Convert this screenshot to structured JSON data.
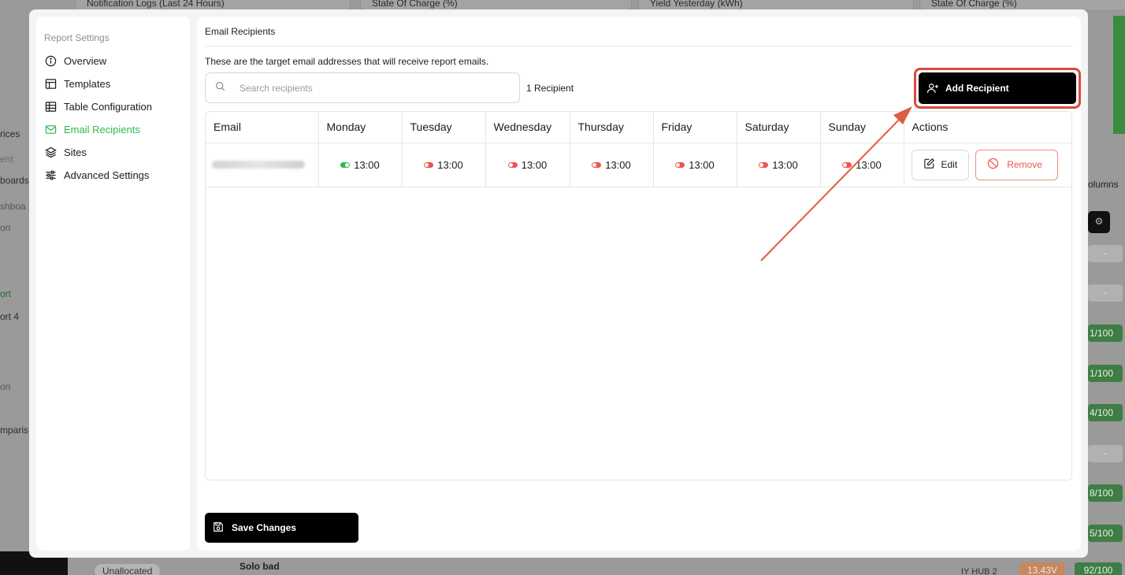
{
  "background": {
    "top_cards": [
      "Notification Logs (Last 24 Hours)",
      "State Of Charge (%)",
      "Yield Yesterday (kWh)",
      "State Of Charge (%)"
    ],
    "left_nav": [
      "rices",
      "ent",
      "boards",
      "shboa",
      "on",
      "ort",
      "ort 4",
      "on",
      "mparis"
    ],
    "right_columns_label": "olumns",
    "right_scores": [
      "1/100",
      "1/100",
      "4/100",
      "8/100",
      "5/100"
    ],
    "bottom_row": {
      "status": "Unallocated",
      "name": "Solo bad",
      "hub": "IY HUB 2",
      "voltage": "13.43V",
      "score": "92/100"
    }
  },
  "sidebar": {
    "title": "Report Settings",
    "items": [
      {
        "label": "Overview",
        "icon": "info-icon",
        "active": false
      },
      {
        "label": "Templates",
        "icon": "layout-icon",
        "active": false
      },
      {
        "label": "Table Configuration",
        "icon": "table-icon",
        "active": false
      },
      {
        "label": "Email Recipients",
        "icon": "mail-icon",
        "active": true
      },
      {
        "label": "Sites",
        "icon": "layers-icon",
        "active": false
      },
      {
        "label": "Advanced Settings",
        "icon": "sliders-icon",
        "active": false
      }
    ]
  },
  "main": {
    "title": "Email Recipients",
    "description": "These are the target email addresses that will receive report emails.",
    "search": {
      "placeholder": "Search recipients",
      "value": ""
    },
    "count_label": "1 Recipient",
    "add_button_label": "Add Recipient",
    "table": {
      "headers": [
        "Email",
        "Monday",
        "Tuesday",
        "Wednesday",
        "Thursday",
        "Friday",
        "Saturday",
        "Sunday",
        "Actions"
      ],
      "rows": [
        {
          "email": "",
          "schedule": [
            {
              "day": "Monday",
              "time": "13:00",
              "enabled": true
            },
            {
              "day": "Tuesday",
              "time": "13:00",
              "enabled": false
            },
            {
              "day": "Wednesday",
              "time": "13:00",
              "enabled": false
            },
            {
              "day": "Thursday",
              "time": "13:00",
              "enabled": false
            },
            {
              "day": "Friday",
              "time": "13:00",
              "enabled": false
            },
            {
              "day": "Saturday",
              "time": "13:00",
              "enabled": false
            },
            {
              "day": "Sunday",
              "time": "13:00",
              "enabled": false
            }
          ],
          "edit_label": "Edit",
          "remove_label": "Remove"
        }
      ]
    },
    "save_button_label": "Save Changes"
  },
  "colors": {
    "accent_green": "#2fb94b",
    "danger_red": "#ef5350",
    "highlight_red": "#d94b3c"
  }
}
